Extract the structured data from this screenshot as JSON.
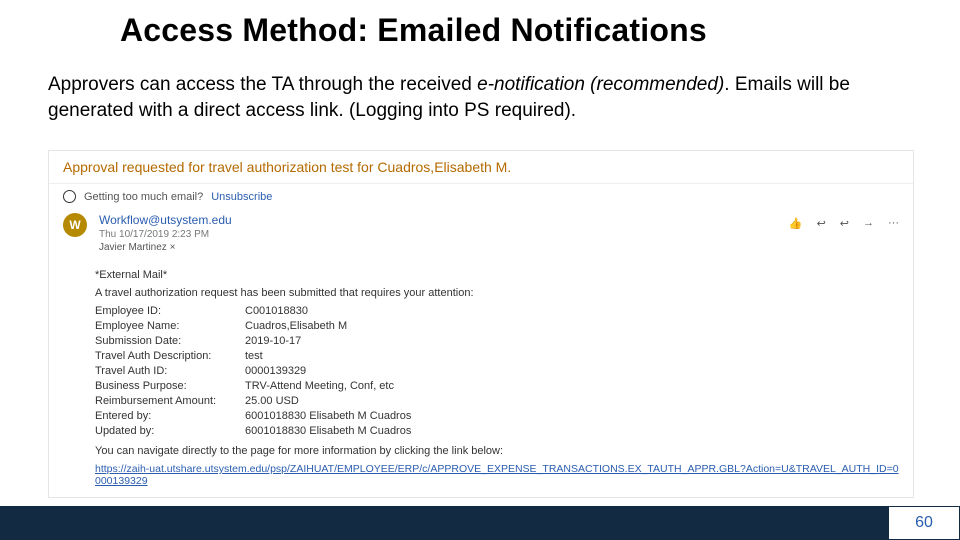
{
  "title": "Access Method: Emailed Notifications",
  "intro_plain1": "Approvers can access the TA through the received ",
  "intro_em": "e-notification (recommended)",
  "intro_plain2": ". Emails will be generated with a direct access link. (Logging into PS required).",
  "email": {
    "subject": "Approval requested for travel authorization test for Cuadros,Elisabeth M.",
    "unsub_text": "Getting too much email?",
    "unsub_link": "Unsubscribe",
    "avatar": "W",
    "from": "Workflow@utsystem.edu",
    "datetime": "Thu 10/17/2019 2:23 PM",
    "to": "Javier Martinez ×",
    "external": "*External Mail*",
    "lead": "A travel authorization request has been submitted that requires your attention:",
    "fields": {
      "emp_id_l": "Employee ID:",
      "emp_id_v": "C001018830",
      "emp_name_l": "Employee Name:",
      "emp_name_v": "Cuadros,Elisabeth M",
      "sub_date_l": "Submission Date:",
      "sub_date_v": "2019-10-17",
      "desc_l": "Travel Auth Description:",
      "desc_v": "test",
      "ta_id_l": "Travel Auth ID:",
      "ta_id_v": "0000139329",
      "bp_l": "Business Purpose:",
      "bp_v": "TRV-Attend Meeting, Conf, etc",
      "amt_l": "Reimbursement Amount:",
      "amt_v": "25.00 USD",
      "ent_l": "Entered by:",
      "ent_v": "6001018830  Elisabeth M Cuadros",
      "upd_l": "Updated by:",
      "upd_v": "6001018830  Elisabeth M Cuadros"
    },
    "nav": "You can navigate directly to the page for more information by clicking the link below:",
    "link": "https://zaih-uat.utshare.utsystem.edu/psp/ZAIHUAT/EMPLOYEE/ERP/c/APPROVE_EXPENSE_TRANSACTIONS.EX_TAUTH_APPR.GBL?Action=U&TRAVEL_AUTH_ID=0000139329"
  },
  "page_number": "60"
}
